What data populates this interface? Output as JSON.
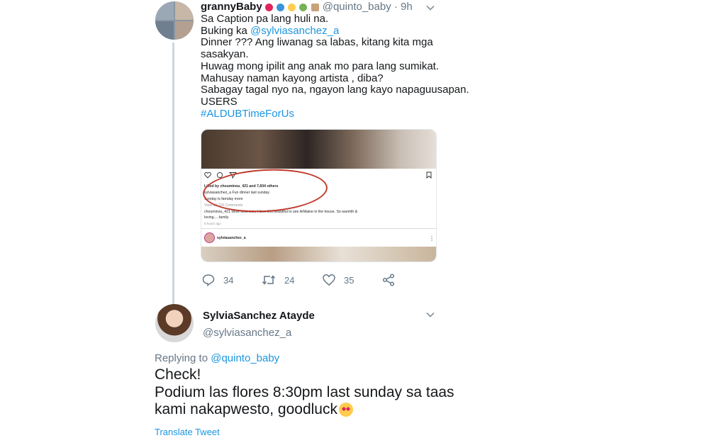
{
  "tweet1": {
    "display_name": "grannyBaby",
    "handle": "@quinto_baby",
    "separator": "·",
    "time": "9h",
    "body_lines": [
      "Sa Caption pa lang huli na.",
      "Buking ka ",
      "Dinner ??? Ang liwanag sa labas, kitang kita mga",
      "sasakyan.",
      "Huwag mong ipilit ang anak mo para lang sumikat.",
      "Mahusay naman kayong artista , diba?",
      "Sabagay tagal nyo na, ngayon lang kayo napaguusapan.",
      "USERS"
    ],
    "mention": "@sylviasanchez_a",
    "hashtag": "#ALDUBTimeForUs",
    "embedded_screenshot": {
      "liked_by": "Liked by chouminou_421 and 7,604 others",
      "caption": "sylviasanchez_a Fun dinner last sunday",
      "caption2": "Sunday is famday   more",
      "comments_link": "View all 224 Comments",
      "comment": "chouminou_421 Wow wow wow I love this beautiful to see ArMaine in the house. So warmth &",
      "comment2": "loving.....family",
      "time_ago": "5 hours ago",
      "profile_handle": "sylviasanchez_a"
    },
    "actions": {
      "reply_count": "34",
      "retweet_count": "24",
      "like_count": "35"
    }
  },
  "tweet2": {
    "display_name": "SylviaSanchez Atayde",
    "handle": "@sylviasanchez_a",
    "replying_prefix": "Replying to ",
    "replying_to": "@quinto_baby",
    "body_lines": [
      "Check!",
      "Podium las flores 8:30pm last sunday sa taas",
      "kami nakapwesto, goodluck"
    ],
    "translate_label": "Translate Tweet"
  },
  "colors": {
    "link": "#1b95e0",
    "muted": "#657786",
    "text": "#14171a",
    "thread_line": "#ccd6dd",
    "annotation_red": "#c0392b"
  }
}
